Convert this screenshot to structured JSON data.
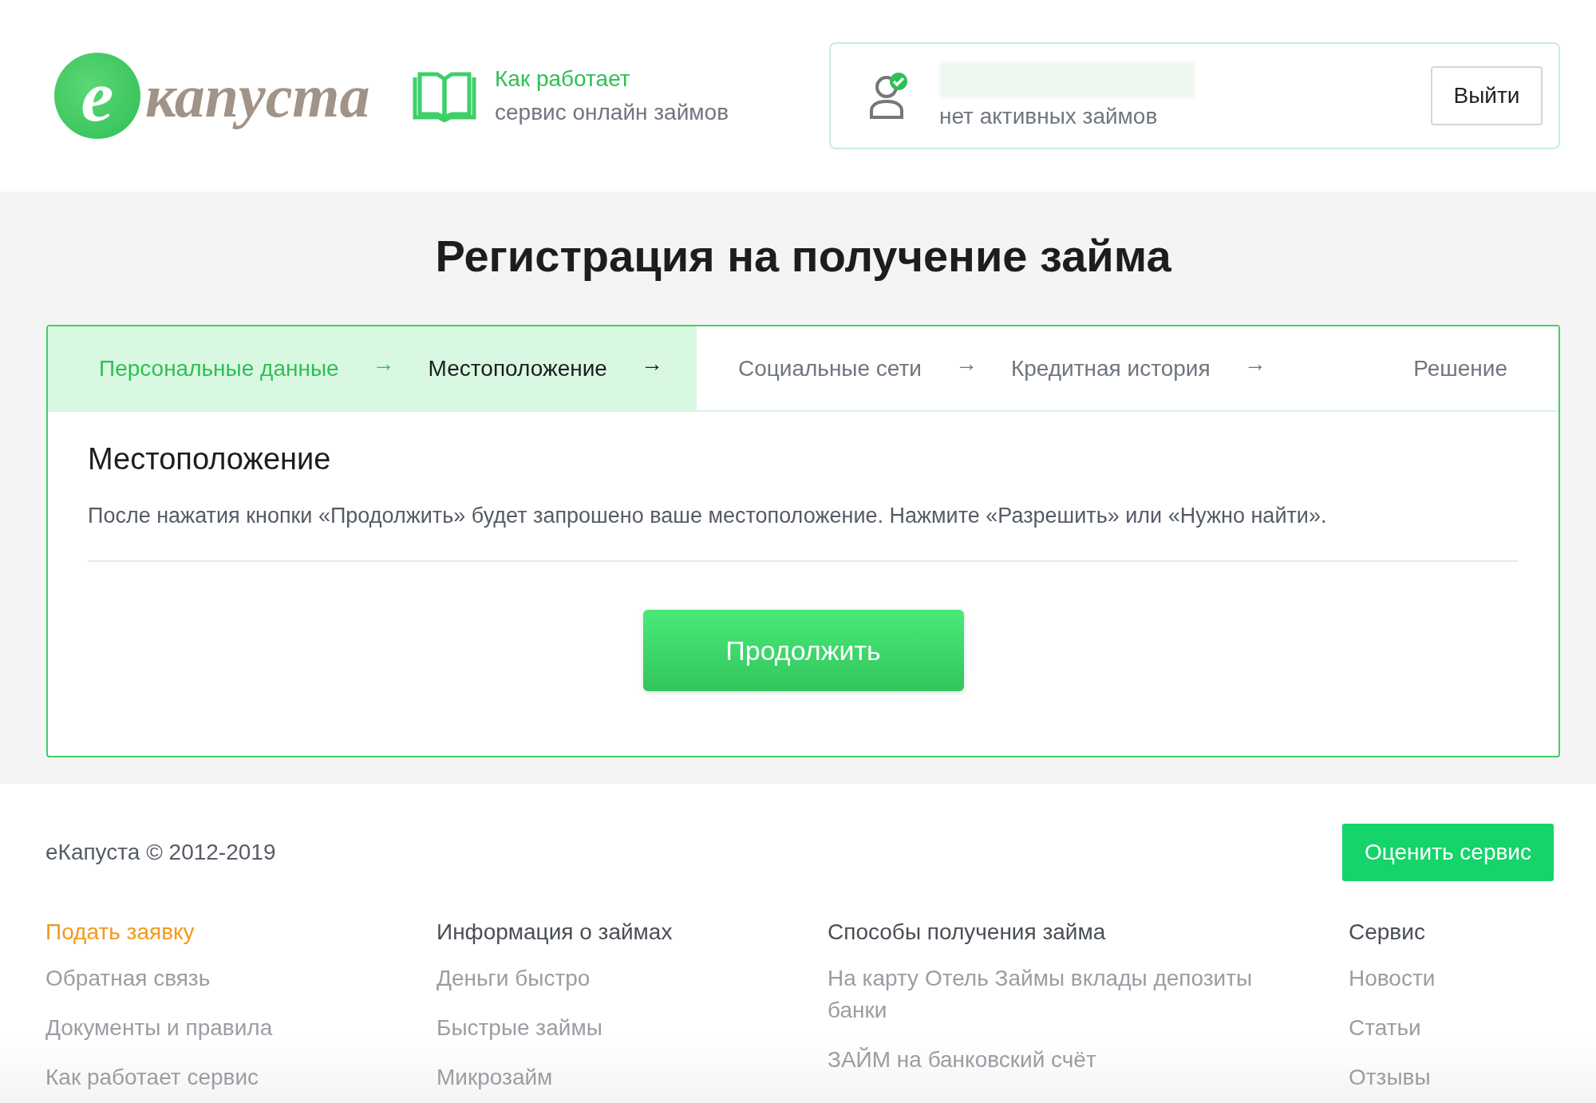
{
  "header": {
    "logo": {
      "mark": "e",
      "text": "капуста"
    },
    "how_it_works": {
      "line_1": "Как работает",
      "line_2": "сервис онлайн займов"
    },
    "account": {
      "status": "нет активных займов",
      "verified": true,
      "logout": "Выйти"
    }
  },
  "page_title": "Регистрация на получение займа",
  "steps": [
    {
      "label": "Персональные данные",
      "done": true,
      "selected": false,
      "arrow": "→"
    },
    {
      "label": "Местоположение",
      "done": false,
      "selected": true,
      "arrow": "→"
    },
    {
      "label": "Социальные сети",
      "done": false,
      "selected": false,
      "arrow": "→"
    },
    {
      "label": "Кредитная история",
      "done": false,
      "selected": false,
      "arrow": "→"
    },
    {
      "label": "Решение",
      "done": false,
      "selected": false
    }
  ],
  "section": {
    "title": "Местоположение",
    "text": "После нажатия кнопки «Продолжить» будет запрошено ваше местоположение. Нажмите «Разрешить» или «Нужно найти».",
    "button": "Продолжить"
  },
  "footer": {
    "copyright": "еКапуста © 2012-2019",
    "rate_button": "Оценить сервис",
    "columns": [
      {
        "heading": "Подать заявку",
        "active": true,
        "links": [
          "Обратная связь",
          "Документы и правила",
          "Как работает сервис"
        ]
      },
      {
        "heading": "Информация о займах",
        "active": false,
        "links": [
          "Деньги быстро",
          "Быстрые займы",
          "Микрозайм"
        ]
      },
      {
        "heading": "Способы получения займа",
        "active": false,
        "links": [
          "На карту Отель Займы вклады депозиты банки",
          "ЗАЙМ на банковский счёт"
        ]
      },
      {
        "heading": "Сервис",
        "active": false,
        "links": [
          "Новости",
          "Статьи",
          "Отзывы"
        ]
      }
    ]
  }
}
